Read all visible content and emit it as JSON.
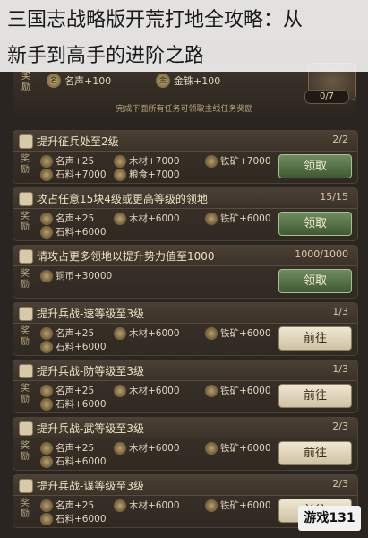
{
  "title": {
    "line1": "三国志战略版开荒打地全攻略：从",
    "line2": "新手到高手的进阶之路"
  },
  "top_panel": {
    "reward_label": "奖励",
    "rewards": [
      "名声+100",
      "金铢+100"
    ],
    "progress": "0/7",
    "footer": "完成下面所有任务可领取主线任务奖励"
  },
  "tasks": [
    {
      "title": "提升征兵处至2级",
      "count": "2/2",
      "reward_label": "奖励",
      "rewards_row1": [
        "名声+25",
        "木材+7000",
        "铁矿+7000"
      ],
      "rewards_row2": [
        "石料+7000",
        "粮食+7000"
      ],
      "button": "领取",
      "button_type": "claim"
    },
    {
      "title": "攻占任意15块4级或更高等级的领地",
      "count": "15/15",
      "reward_label": "奖励",
      "rewards_row1": [
        "名声+25",
        "木材+6000",
        "铁矿+6000"
      ],
      "rewards_row2": [
        "石料+6000"
      ],
      "button": "领取",
      "button_type": "claim"
    },
    {
      "title": "请攻占更多领地以提升势力值至1000",
      "count": "1000/1000",
      "reward_label": "奖励",
      "rewards_row1": [
        "铜币+30000"
      ],
      "rewards_row2": [],
      "button": "领取",
      "button_type": "claim"
    },
    {
      "title": "提升兵战-速等级至3级",
      "count": "1/3",
      "reward_label": "奖励",
      "rewards_row1": [
        "名声+25",
        "木材+6000",
        "铁矿+6000"
      ],
      "rewards_row2": [
        "石料+6000"
      ],
      "button": "前往",
      "button_type": "go"
    },
    {
      "title": "提升兵战-防等级至3级",
      "count": "1/3",
      "reward_label": "奖励",
      "rewards_row1": [
        "名声+25",
        "木材+6000",
        "铁矿+6000"
      ],
      "rewards_row2": [
        "石料+6000"
      ],
      "button": "前往",
      "button_type": "go"
    },
    {
      "title": "提升兵战-武等级至3级",
      "count": "2/3",
      "reward_label": "奖励",
      "rewards_row1": [
        "名声+25",
        "木材+6000",
        "铁矿+6000"
      ],
      "rewards_row2": [
        "石料+6000"
      ],
      "button": "前往",
      "button_type": "go"
    },
    {
      "title": "提升兵战-谋等级至3级",
      "count": "2/3",
      "reward_label": "奖励",
      "rewards_row1": [
        "名声+25",
        "木材+6000",
        "铁矿+6000"
      ],
      "rewards_row2": [
        "石料+6000"
      ],
      "button": "前往",
      "button_type": "go"
    }
  ],
  "watermark": "游戏131"
}
